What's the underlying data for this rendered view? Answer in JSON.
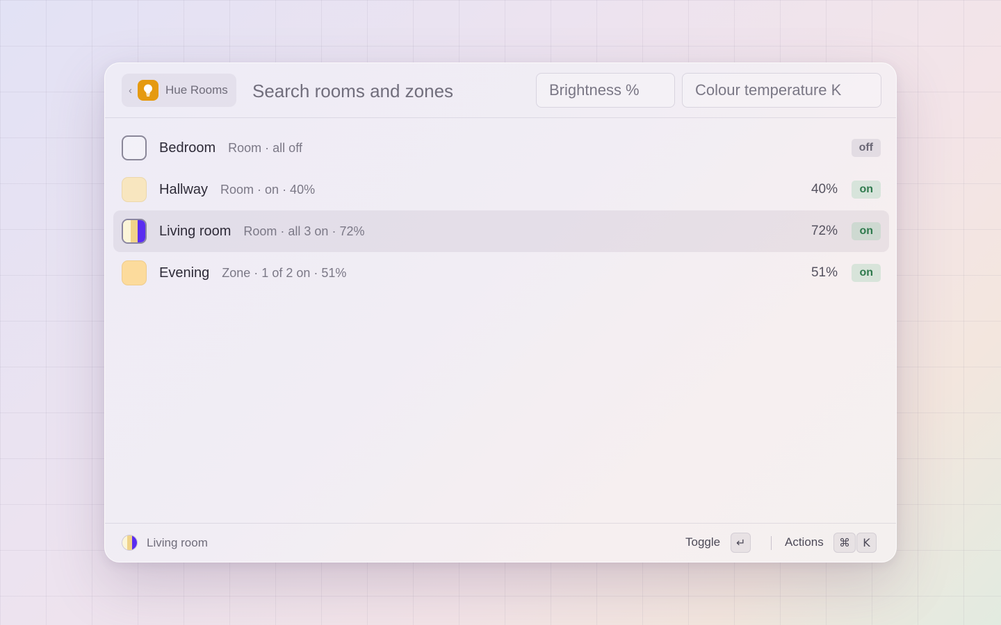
{
  "header": {
    "back_chip_label": "Hue Rooms",
    "back_chevron": "‹",
    "app_icon": "lightbulb-icon",
    "search_placeholder": "Search rooms and zones",
    "brightness_placeholder": "Brightness %",
    "temperature_placeholder": "Colour temperature K"
  },
  "rooms": [
    {
      "name": "Bedroom",
      "subtitle": "Room · all off",
      "brightness": "",
      "status": "off",
      "swatch": "off",
      "selected": false
    },
    {
      "name": "Hallway",
      "subtitle": "Room · on · 40%",
      "brightness": "40%",
      "status": "on",
      "swatch": "pale-yellow",
      "selected": false
    },
    {
      "name": "Living room",
      "subtitle": "Room · all 3 on · 72%",
      "brightness": "72%",
      "status": "on",
      "swatch": "split",
      "selected": true
    },
    {
      "name": "Evening",
      "subtitle": "Zone · 1 of 2 on · 51%",
      "brightness": "51%",
      "status": "on",
      "swatch": "warm-yellow",
      "selected": false
    }
  ],
  "footer": {
    "selected_label": "Living room",
    "toggle_label": "Toggle",
    "toggle_key": "↵",
    "actions_label": "Actions",
    "actions_key_1": "⌘",
    "actions_key_2": "K"
  },
  "colors": {
    "app_icon_bg": "#e59a10",
    "split_swatch": [
      "#fbf5d8",
      "#f0d389",
      "#5a2df0"
    ],
    "on_badge_bg": "#d8eedd",
    "on_badge_text": "#2f7a4d",
    "off_badge_bg": "#e2dfe6"
  }
}
